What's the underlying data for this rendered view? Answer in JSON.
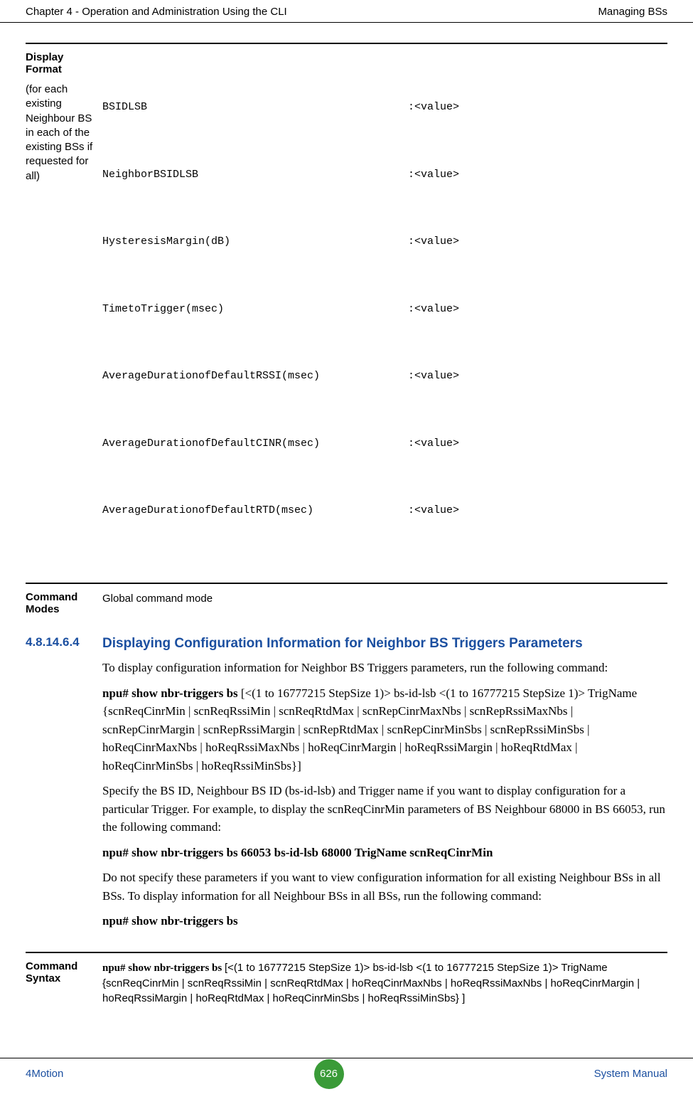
{
  "header": {
    "left": "Chapter 4 - Operation and Administration Using the CLI",
    "right": "Managing BSs"
  },
  "displayFormat": {
    "label": "Display Format",
    "sub": "(for each existing Neighbour BS in each of the existing BSs if requested for all)",
    "rows": [
      {
        "key": "BSIDLSB",
        "val": ":<value>"
      },
      {
        "key": "NeighborBSIDLSB",
        "val": ":<value>"
      },
      {
        "key": "HysteresisMargin(dB)",
        "val": ":<value>"
      },
      {
        "key": "TimetoTrigger(msec)",
        "val": ":<value>"
      },
      {
        "key": "AverageDurationofDefaultRSSI(msec)",
        "val": ":<value>"
      },
      {
        "key": "AverageDurationofDefaultCINR(msec)",
        "val": ":<value>"
      },
      {
        "key": "AverageDurationofDefaultRTD(msec)",
        "val": ":<value>"
      }
    ]
  },
  "commandModes": {
    "label": "Command Modes",
    "value": "Global command mode"
  },
  "section": {
    "num": "4.8.14.6.4",
    "title": "Displaying Configuration Information for Neighbor BS Triggers Parameters",
    "p1": "To display configuration information for Neighbor BS Triggers parameters, run the following command:",
    "cmd1_bold": "npu# show nbr-triggers bs ",
    "cmd1_rest": "[<(1 to 16777215 StepSize 1)> bs-id-lsb <(1 to 16777215 StepSize 1)> TrigName {scnReqCinrMin | scnReqRssiMin | scnReqRtdMax | scnRepCinrMaxNbs | scnRepRssiMaxNbs | scnRepCinrMargin | scnRepRssiMargin | scnRepRtdMax | scnRepCinrMinSbs | scnRepRssiMinSbs | hoReqCinrMaxNbs | hoReqRssiMaxNbs | hoReqCinrMargin | hoReqRssiMargin | hoReqRtdMax | hoReqCinrMinSbs | hoReqRssiMinSbs}]",
    "p3": "Specify the BS ID, Neighbour BS ID (bs-id-lsb) and Trigger name if you want to display configuration for a particular Trigger. For example, to display the scnReqCinrMin parameters of BS Neighbour 68000 in BS 66053, run the following command:",
    "cmd2": "npu# show nbr-triggers bs 66053 bs-id-lsb 68000 TrigName scnReqCinrMin",
    "p4": "Do not specify these parameters if you want to view configuration information for all existing Neighbour BSs in all BSs. To display information for all Neighbour BSs in all BSs, run the following command:",
    "cmd3": "npu# show nbr-triggers bs"
  },
  "commandSyntax": {
    "label": "Command Syntax",
    "bold": "npu# show nbr-triggers bs ",
    "rest": "[<(1 to 16777215 StepSize 1)> bs-id-lsb <(1 to 16777215 StepSize 1)> TrigName {scnReqCinrMin | scnReqRssiMin | scnReqRtdMax | hoReqCinrMaxNbs | hoReqRssiMaxNbs | hoReqCinrMargin | hoReqRssiMargin | hoReqRtdMax | hoReqCinrMinSbs | hoReqRssiMinSbs} ]"
  },
  "footer": {
    "left": "4Motion",
    "page": "626",
    "right": "System Manual"
  }
}
